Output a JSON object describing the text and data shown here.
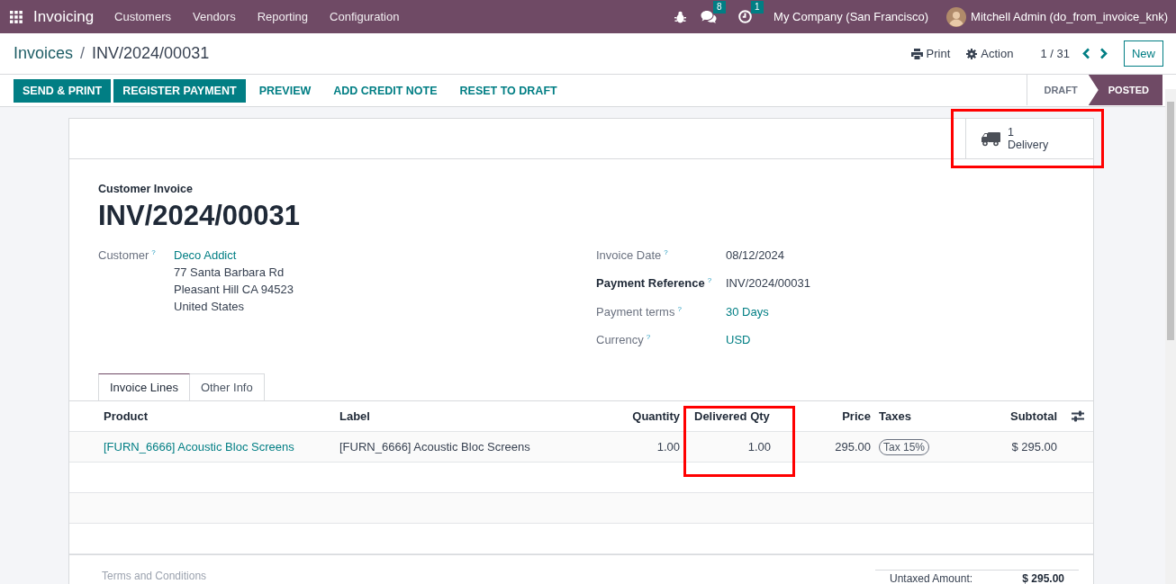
{
  "navbar": {
    "app": "Invoicing",
    "menu": [
      "Customers",
      "Vendors",
      "Reporting",
      "Configuration"
    ],
    "messages_count": "8",
    "activities_count": "1",
    "company": "My Company (San Francisco)",
    "user": "Mitchell Admin (do_from_invoice_knk)"
  },
  "breadcrumb": {
    "parent": "Invoices",
    "separator": "/",
    "current": "INV/2024/00031"
  },
  "actions": {
    "print": "Print",
    "action": "Action",
    "pager": "1 / 31",
    "new": "New"
  },
  "buttons": [
    {
      "label": "SEND & PRINT",
      "kind": "primary"
    },
    {
      "label": "REGISTER PAYMENT",
      "kind": "primary"
    },
    {
      "label": "PREVIEW",
      "kind": "secondary"
    },
    {
      "label": "ADD CREDIT NOTE",
      "kind": "secondary"
    },
    {
      "label": "RESET TO DRAFT",
      "kind": "secondary"
    }
  ],
  "statusbar": [
    {
      "label": "DRAFT",
      "selected": false
    },
    {
      "label": "POSTED",
      "selected": true
    }
  ],
  "smart_button": {
    "count": "1",
    "label": "Delivery",
    "highlighted": true
  },
  "invoice": {
    "type": "Customer Invoice",
    "number": "INV/2024/00031"
  },
  "customer": {
    "label": "Customer",
    "help": "?",
    "name": "Deco Addict",
    "address": [
      "77 Santa Barbara Rd",
      "Pleasant Hill CA 94523",
      "United States"
    ]
  },
  "fields": [
    {
      "label": "Invoice Date",
      "help": "?",
      "value": "08/12/2024",
      "required": false,
      "kind": "text"
    },
    {
      "label": "Payment Reference",
      "help": "?",
      "value": "INV/2024/00031",
      "required": true,
      "kind": "text"
    },
    {
      "label": "Payment terms",
      "help": "?",
      "value": "30 Days",
      "required": false,
      "kind": "link"
    },
    {
      "label": "Currency",
      "help": "?",
      "value": "USD",
      "required": false,
      "kind": "link"
    }
  ],
  "tabs": [
    {
      "label": "Invoice Lines",
      "selected": true
    },
    {
      "label": "Other Info",
      "selected": false
    }
  ],
  "table": {
    "columns": [
      {
        "label": "Product",
        "highlighted": false
      },
      {
        "label": "Label",
        "highlighted": false
      },
      {
        "label": "Quantity",
        "highlighted": false
      },
      {
        "label": "Delivered Qty",
        "highlighted": true
      },
      {
        "label": "Price",
        "highlighted": false
      },
      {
        "label": "Taxes",
        "highlighted": false
      },
      {
        "label": "Subtotal",
        "highlighted": false
      }
    ],
    "rows": [
      {
        "cells": [
          {
            "text": "[FURN_6666] Acoustic Bloc Screens",
            "kind": "link"
          },
          {
            "text": "[FURN_6666] Acoustic Bloc Screens",
            "kind": "text"
          },
          {
            "text": "1.00",
            "kind": "number"
          },
          {
            "text": "1.00",
            "kind": "number"
          },
          {
            "text": "295.00",
            "kind": "number"
          },
          {
            "text": "Tax 15%",
            "kind": "tag"
          },
          {
            "text": "$ 295.00",
            "kind": "number"
          }
        ]
      }
    ]
  },
  "footer": {
    "terms_placeholder": "Terms and Conditions",
    "totals": [
      {
        "label": "Untaxed Amount:",
        "value": "$ 295.00"
      }
    ]
  }
}
